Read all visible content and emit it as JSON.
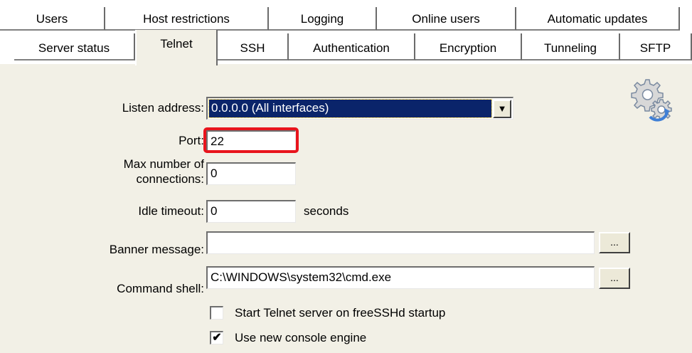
{
  "tabs_row1": [
    "Users",
    "Host restrictions",
    "Logging",
    "Online users",
    "Automatic updates"
  ],
  "tabs_row2": [
    "Server status",
    "Telnet",
    "SSH",
    "Authentication",
    "Encryption",
    "Tunneling",
    "SFTP"
  ],
  "active_tab": "Telnet",
  "telnet": {
    "listen_address_label": "Listen address:",
    "listen_address_value": "0.0.0.0 (All interfaces)",
    "port_label": "Port:",
    "port_value": "22",
    "max_connections_label_line1": "Max number of",
    "max_connections_label_line2": "connections:",
    "max_connections_value": "0",
    "idle_timeout_label": "Idle timeout:",
    "idle_timeout_value": "0",
    "idle_timeout_unit": "seconds",
    "banner_label": "Banner message:",
    "banner_value": "",
    "banner_browse": "...",
    "shell_label": "Command shell:",
    "shell_value": "C:\\WINDOWS\\system32\\cmd.exe",
    "shell_browse": "...",
    "startup_label": "Start Telnet server on freeSSHd startup",
    "startup_checked": false,
    "console_label": "Use new console engine",
    "console_checked": true,
    "check_mark": "✔",
    "dropdown_arrow": "▼"
  },
  "icons": {
    "settings": "gears-refresh-icon"
  },
  "colors": {
    "panel_bg": "#f2f0e6",
    "selection_bg": "#0a246a",
    "highlight_border": "#e8141c",
    "gear_blue": "#6b8fc8"
  }
}
